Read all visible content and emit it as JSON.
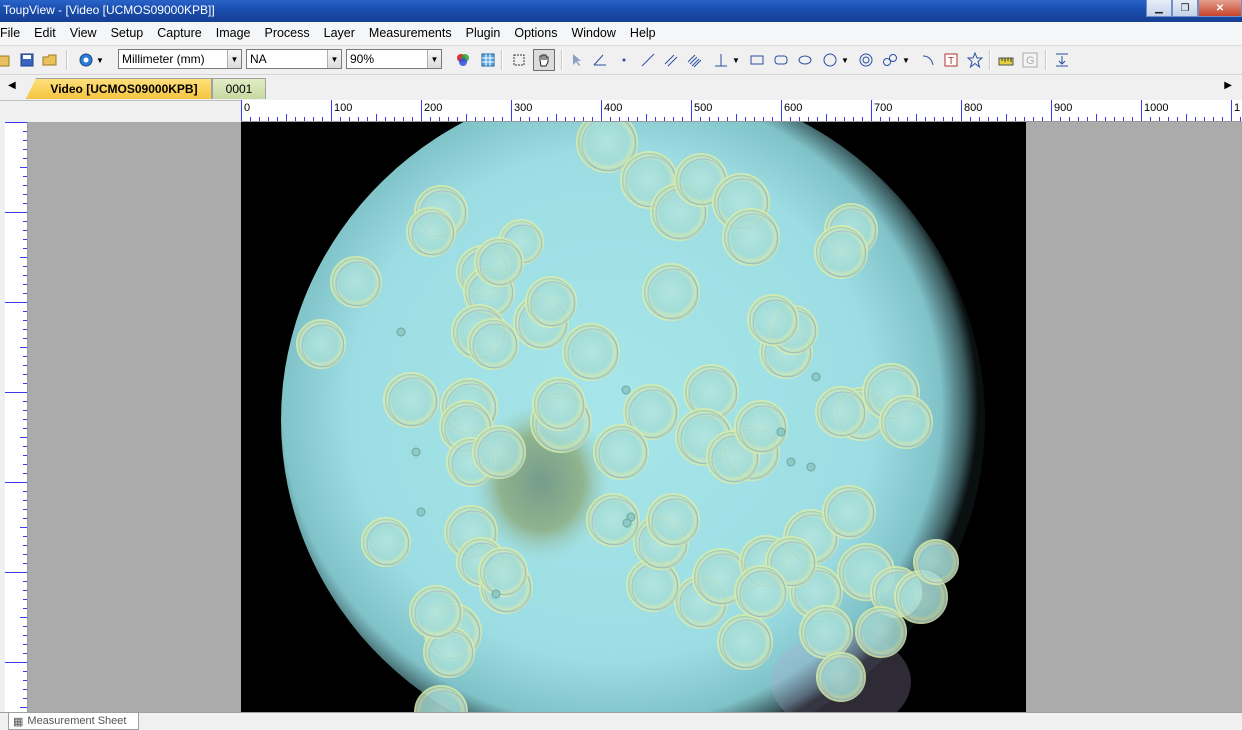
{
  "window": {
    "title": "ToupView - [Video [UCMOS09000KPB]]"
  },
  "menu": [
    "File",
    "Edit",
    "View",
    "Setup",
    "Capture",
    "Image",
    "Process",
    "Layer",
    "Measurements",
    "Plugin",
    "Options",
    "Window",
    "Help"
  ],
  "toolbar": {
    "unit": "Millimeter (mm)",
    "magnification": "NA",
    "zoom": "90%"
  },
  "tabs": [
    {
      "label": "Video [UCMOS09000KPB]",
      "active": true
    },
    {
      "label": "0001",
      "active": false
    }
  ],
  "ruler": {
    "labels": [
      "0",
      "100",
      "200",
      "300",
      "400",
      "500",
      "600",
      "700",
      "800",
      "900",
      "1000",
      "1"
    ]
  },
  "bottom": {
    "sheet_label": "Measurement Sheet"
  },
  "colors": {
    "titlebar": "#1a4fb0",
    "active_tab": "#f5c440",
    "inactive_tab": "#c7d9a0",
    "ruler_tick": "#3a3af0"
  }
}
